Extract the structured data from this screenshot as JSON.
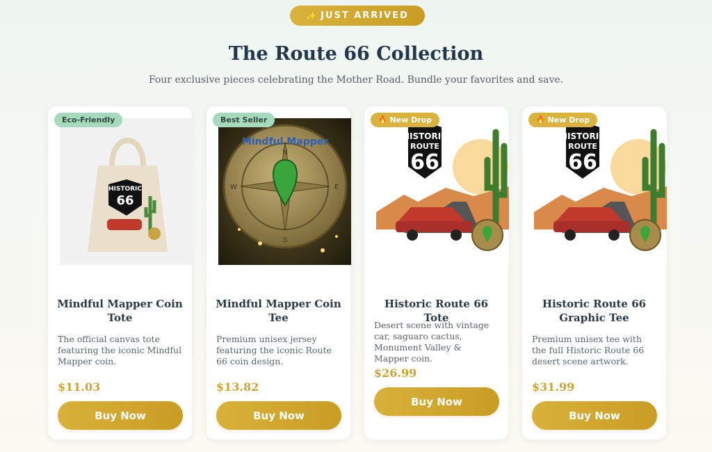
{
  "header": {
    "pill_icon": "sparkles-icon",
    "pill_label": "JUST ARRIVED",
    "title": "The Route 66 Collection",
    "subtitle": "Four exclusive pieces celebrating the Mother Road. Bundle your favorites and save."
  },
  "colors": {
    "accent": "#cfa32d",
    "badge_green": "#a7d9bd",
    "heading": "#23364a"
  },
  "products": [
    {
      "badge": "Eco-Friendly",
      "title": "Mindful Mapper Coin Tote",
      "description": "The official canvas tote featuring the iconic Mindful Mapper coin.",
      "price": "$11.03",
      "button": "Buy Now"
    },
    {
      "badge": "Best Seller",
      "title": "Mindful Mapper Coin Tee",
      "description": "Premium unisex jersey featuring the iconic Route 66 coin design.",
      "price": "$13.82",
      "button": "Buy Now"
    },
    {
      "badge": "New Drop",
      "badge_icon": "flame-icon",
      "title": "Historic Route 66 Tote",
      "description": "Desert scene with vintage car, saguaro cactus, Monument Valley & Mapper coin.",
      "price": "$26.99",
      "button": "Buy Now"
    },
    {
      "badge": "New Drop",
      "badge_icon": "flame-icon",
      "title": "Historic Route 66 Graphic Tee",
      "description": "Premium unisex tee with the full Historic Route 66 desert scene artwork.",
      "price": "$31.99",
      "button": "Buy Now"
    }
  ],
  "artwork": {
    "sign_line1": "HISTORIC",
    "sign_line2": "ROUTE",
    "sign_number": "66",
    "coin_text": "Mindful Mapper",
    "compass_letters": [
      "N",
      "E",
      "S",
      "W"
    ]
  }
}
